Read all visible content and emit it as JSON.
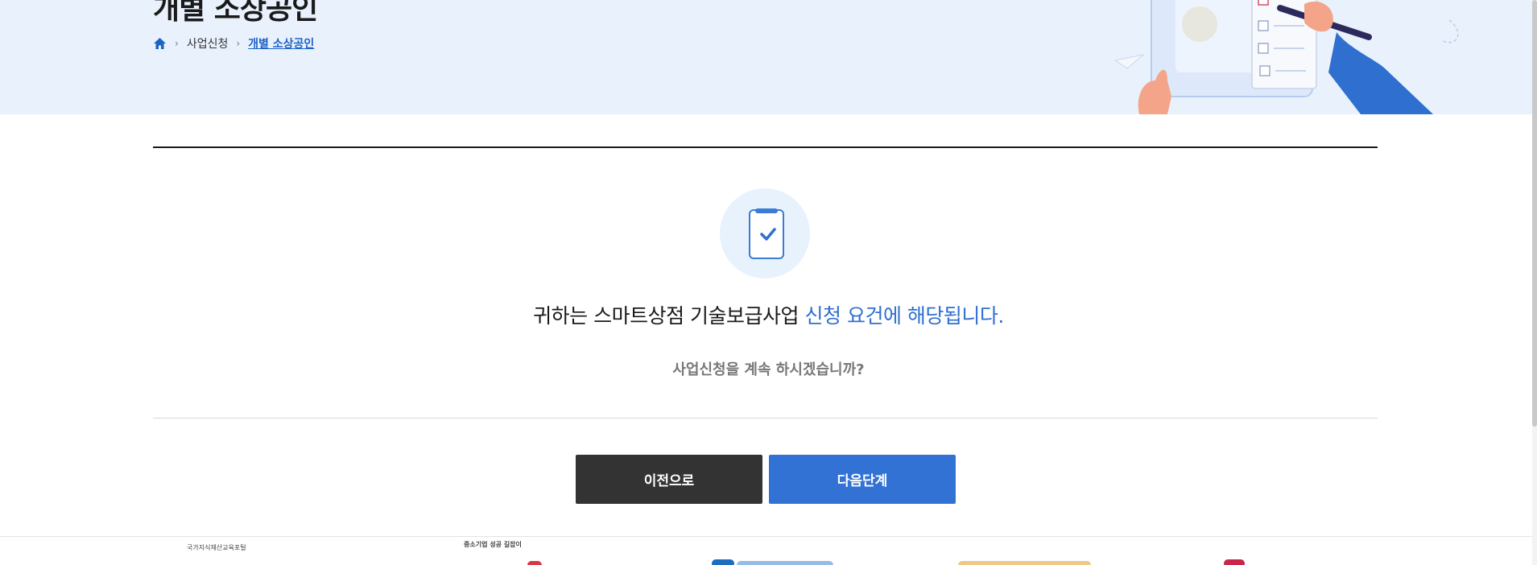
{
  "header": {
    "title": "개별 소상공인",
    "breadcrumb": {
      "home_icon": "home-icon",
      "items": [
        "사업신청",
        "개별 소상공인"
      ]
    }
  },
  "result": {
    "icon": "clipboard-check-icon",
    "message_part1": "귀하는 스마트상점 기술보급사업 ",
    "message_highlight": "신청 요건에 해당됩니다.",
    "question": "사업신청을 계속 하시겠습니까?"
  },
  "buttons": {
    "prev_label": "이전으로",
    "next_label": "다음단계"
  },
  "footer": {
    "partners": [
      "국가지식재산교육포털",
      "중소기업 성공 길잡이"
    ]
  },
  "colors": {
    "accent": "#2f6fd0",
    "banner_bg": "#e9f1fd",
    "prev_button": "#333333",
    "next_button": "#3272d4"
  }
}
